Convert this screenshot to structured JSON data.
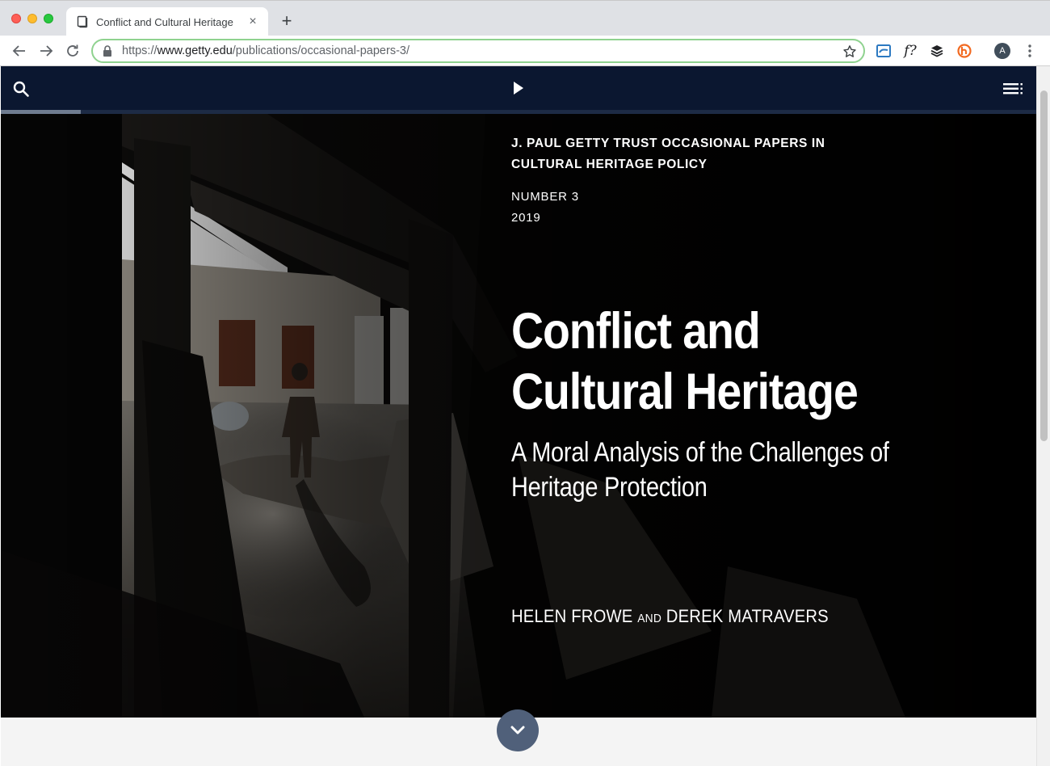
{
  "browser": {
    "tab_title": "Conflict and Cultural Heritage",
    "tab_close": "×",
    "new_tab": "+",
    "url_scheme": "https://",
    "url_host": "www.getty.edu",
    "url_path": "/publications/occasional-papers-3/",
    "extension_font": "f?",
    "profile_initial": "A",
    "accent_color": "#8fd28f"
  },
  "nav": {
    "icons": [
      "search-icon",
      "play-icon",
      "table-of-contents-icon"
    ],
    "background": "#0b1730",
    "reading_progress": 0.077
  },
  "cover": {
    "series": "J. Paul Getty Trust Occasional Papers in Cultural Heritage Policy",
    "number": "NUMBER 3",
    "year": "2019",
    "title_line1": "Conflict and",
    "title_line2": "Cultural Heritage",
    "subtitle_line1": "A Moral Analysis of the Challenges of",
    "subtitle_line2": "Heritage Protection",
    "author1": "HELEN FROWE",
    "author_join": "AND",
    "author2": "DEREK MATRAVERS"
  },
  "scroll_icon": "chevron-down-icon"
}
